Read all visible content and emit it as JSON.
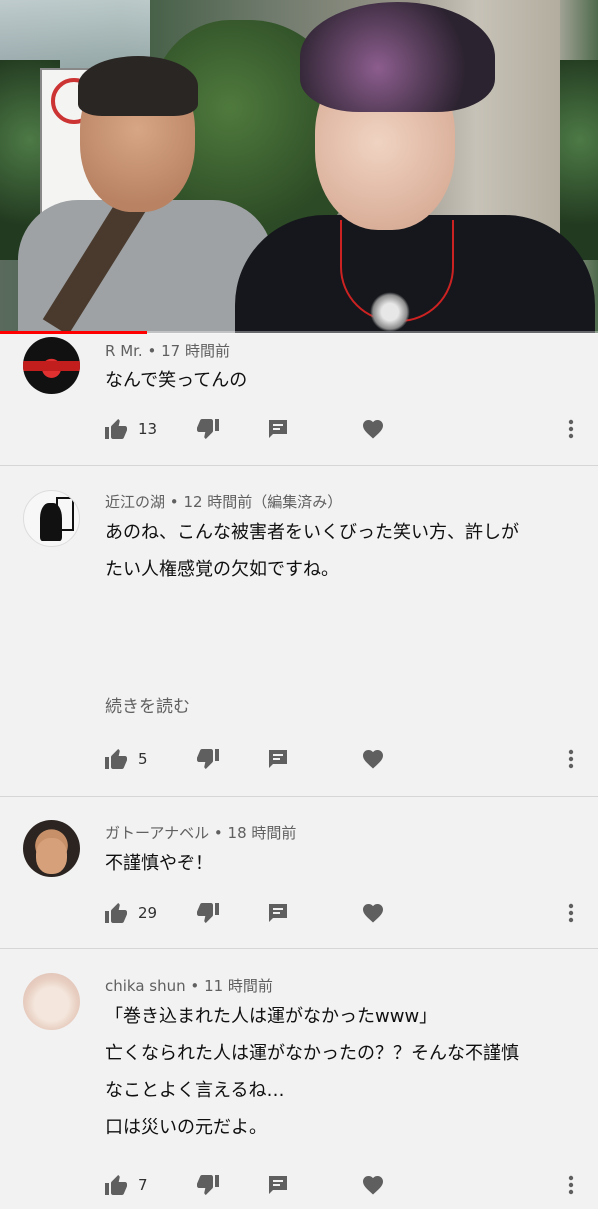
{
  "video": {
    "progress_fraction": 0.245
  },
  "colors": {
    "progress": "#ff0000",
    "meta_text": "#606060",
    "divider": "#d6d6d6",
    "background": "#f2f2f2"
  },
  "icons": {
    "like": "thumb-up-icon",
    "dislike": "thumb-down-icon",
    "reply": "reply-comment-icon",
    "heart": "heart-icon",
    "more": "more-vert-icon"
  },
  "comments": [
    {
      "author": "R Mr.",
      "time": "17 時間前",
      "lines": [
        "なんで笑ってんの"
      ],
      "likes": "13"
    },
    {
      "author": "近江の湖",
      "time": "12 時間前（編集済み）",
      "lines": [
        "あのね、こんな被害者をいくびった笑い方、許しが",
        "たい人権感覚の欠如ですね。"
      ],
      "read_more": "続きを読む",
      "likes": "5"
    },
    {
      "author": "ガトーアナベル",
      "time": "18 時間前",
      "lines": [
        "不謹慎やぞ！"
      ],
      "likes": "29"
    },
    {
      "author": "chika shun",
      "time": "11 時間前",
      "lines": [
        "「巻き込まれた人は運がなかったwww」",
        "亡くなられた人は運がなかったの？？そんな不謹慎",
        "なことよく言えるね…",
        "口は災いの元だよ。"
      ],
      "likes": "7"
    }
  ],
  "separator": "•"
}
